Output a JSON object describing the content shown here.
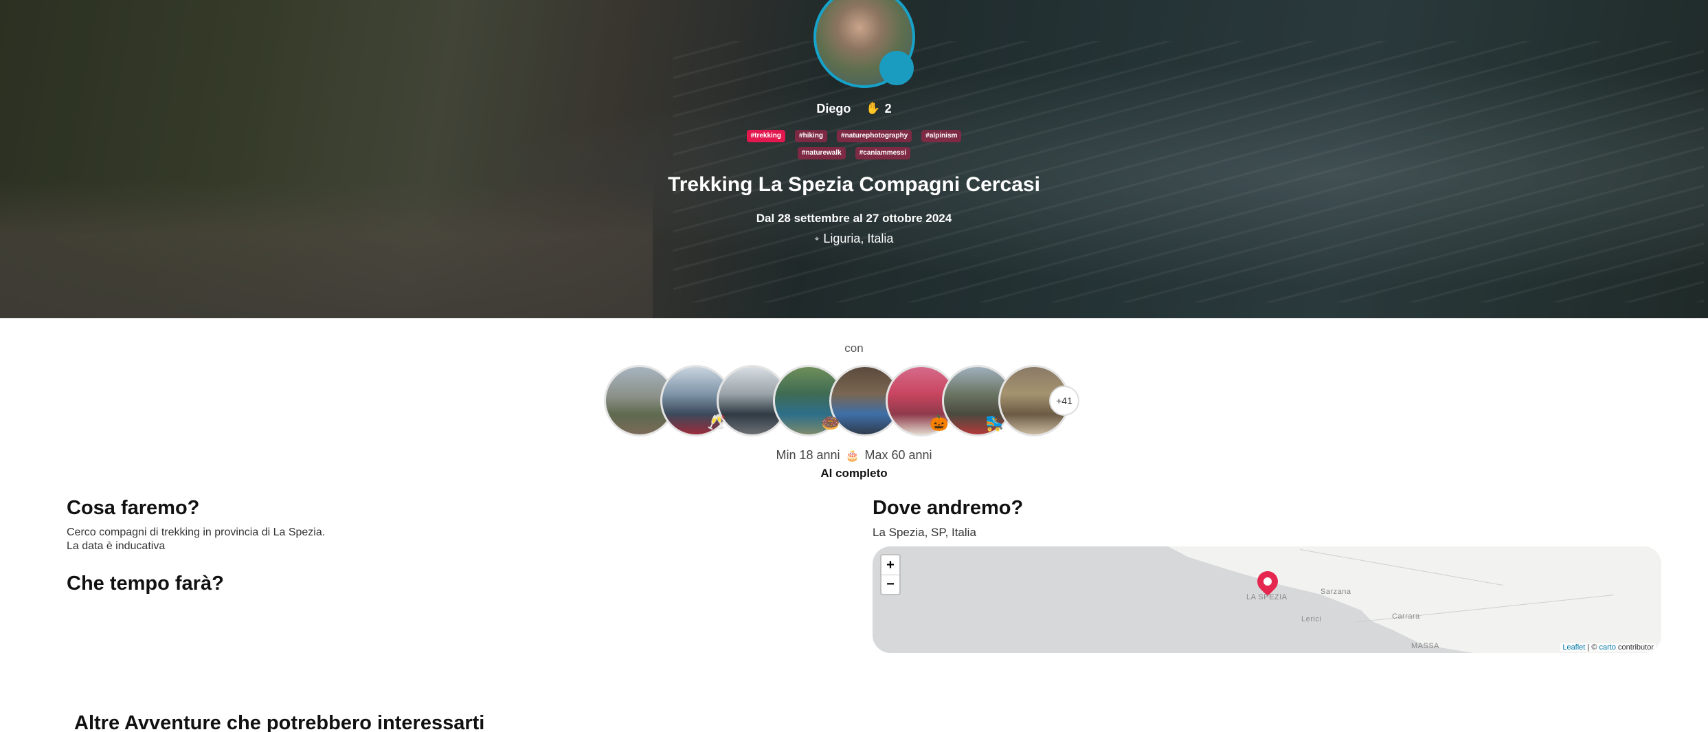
{
  "host": {
    "name": "Diego",
    "count": "2",
    "count_icon": "raised-hand-icon"
  },
  "tags": [
    {
      "label": "#trekking",
      "highlight": true
    },
    {
      "label": "#hiking",
      "highlight": false
    },
    {
      "label": "#naturephotography",
      "highlight": false
    },
    {
      "label": "#alpinism",
      "highlight": false
    },
    {
      "label": "#naturewalk",
      "highlight": false
    },
    {
      "label": "#caniammessi",
      "highlight": false
    }
  ],
  "trip": {
    "title": "Trekking La Spezia Compagni Cercasi",
    "dates": "Dal 28 settembre al 27 ottobre 2024",
    "location": "Liguria, Italia"
  },
  "participants": {
    "label": "con",
    "more": "+41",
    "age_min": "Min 18 anni",
    "age_max": "Max 60 anni",
    "status": "Al completo"
  },
  "sections": {
    "what_title": "Cosa faremo?",
    "what_text_1": "Cerco compagni di trekking in provincia di La Spezia.",
    "what_text_2": "La data è inducativa",
    "weather_title": "Che tempo farà?",
    "where_title": "Dove andremo?",
    "where_text": "La Spezia, SP, Italia",
    "more_title": "Altre Avventure che potrebbero interessarti"
  },
  "map": {
    "zoom_in": "+",
    "zoom_out": "−",
    "labels": {
      "la_spezia": "LA SPEZIA",
      "sarzana": "Sarzana",
      "lerici": "Lerici",
      "carrara": "Carrara",
      "massa": "MASSA"
    },
    "attribution_leaflet": "Leaflet",
    "attribution_sep": " | © ",
    "attribution_carto": "carto",
    "attribution_rest": " contributor"
  },
  "colors": {
    "accent": "#e3184f",
    "avatar_ring": "#17a2c9"
  }
}
